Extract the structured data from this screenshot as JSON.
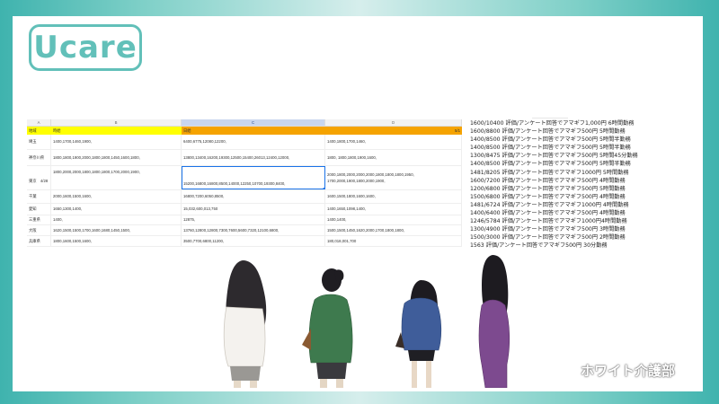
{
  "logo": {
    "text": "Ucare"
  },
  "sheet": {
    "columns": [
      "A",
      "B",
      "C",
      "D"
    ],
    "header": {
      "region": "地域",
      "hourly": "時給",
      "daily": "日給",
      "date": "5/1"
    },
    "rows": [
      {
        "region": "埼玉",
        "hourly": "1400,1700,1460,1900,",
        "daily": "6400,6775,12080,12200,",
        "d": "1400,1800,1700,1460,"
      },
      {
        "region": "神奈川県",
        "hourly": "1800,1800,1900,2000,1800,1800,1450,1600,1800,",
        "daily": "13800,13400,16200,19300,12500,15400,26013,12400,12000,",
        "d": "1800,  1800,1800,1900,1600,"
      },
      {
        "region": "東京　4/28",
        "hourly": "1800,2000,2000,1800,1800,1800,1700,2000,1900,",
        "daily": "15200,16800,16800,8500,14000,12250,10700,19300,8400,",
        "d": "2000,1800,2000,2000,2000,1800,1800,1800,1950,",
        "d2": "1700,2000,1900,1800,2000,1900,"
      },
      {
        "region": "千葉",
        "hourly": "2000,1600,1500,1600,",
        "daily": "16800,7200,6050,8500,",
        "d": "1600,1500,1800,1600,1600,"
      },
      {
        "region": "愛知",
        "hourly": "1650,1300,1400,",
        "daily": "15,032,600,013,750",
        "d": "1400,1650,1098,1400,"
      },
      {
        "region": "三重県",
        "hourly": "1400,",
        "daily": "12875,",
        "d": "1400,1400,"
      },
      {
        "region": "大阪",
        "hourly": "1620,1500,1500,1700,1600,1680,1450,1500,",
        "daily": "13760,12800,12800,7300,7600,5600,7320,12100,6800,",
        "d": "1500,1500,1450,1620,2000,1700,1800,1800,"
      },
      {
        "region": "兵庫県",
        "hourly": "1800,1600,1500,1600,",
        "daily": "3500,7700,6800,11200,",
        "d": "180,018,001,700"
      }
    ]
  },
  "list": [
    "1600/10400 評価/アンケート回答でアマギフ1,000円 6時間勤務",
    "1600/8800 評価/アンケート回答でアマギフ500円 5時間勤務",
    "1400/8500 評価/アンケート回答でアマギフ500円 5時間半勤務",
    "1400/8500 評価/アンケート回答でアマギフ500円 5時間半勤務",
    "1300/8475 評価/アンケート回答でアマギフ500円 5時間45分勤務",
    "1400/8500 評価/アンケート回答でアマギフ500円 5時間半勤務",
    "1481/8205 評価/アンケート回答でアマギフ1000円 5時間勤務",
    "1600/7200 評価/アンケート回答でアマギフ500円 4時間勤務",
    "1200/6800 評価/アンケート回答でアマギフ500円 5時間勤務",
    "1500/6800 評価/アンケート回答でアマギフ500円 4時間勤務",
    "1481/6724 評価/アンケート回答でアマギフ1000円 4時間勤務",
    "1400/6400 評価/アンケート回答でアマギフ500円 4時間勤務",
    "1246/5784 評価/アンケート回答でアマギフ1000円4時間勤務",
    "1300/4900 評価/アンケート回答でアマギフ500円 3時間勤務",
    "1500/3000 評価/アンケート回答でアマギフ500円 2時間勤務",
    "1563 評価/アンケート回答でアマギフ500円 30分勤務"
  ],
  "brand": {
    "text": "ホワイト介護部"
  },
  "colors": {
    "accent": "#62c0b9",
    "yellow": "#ffff00",
    "orange": "#f5a300"
  }
}
